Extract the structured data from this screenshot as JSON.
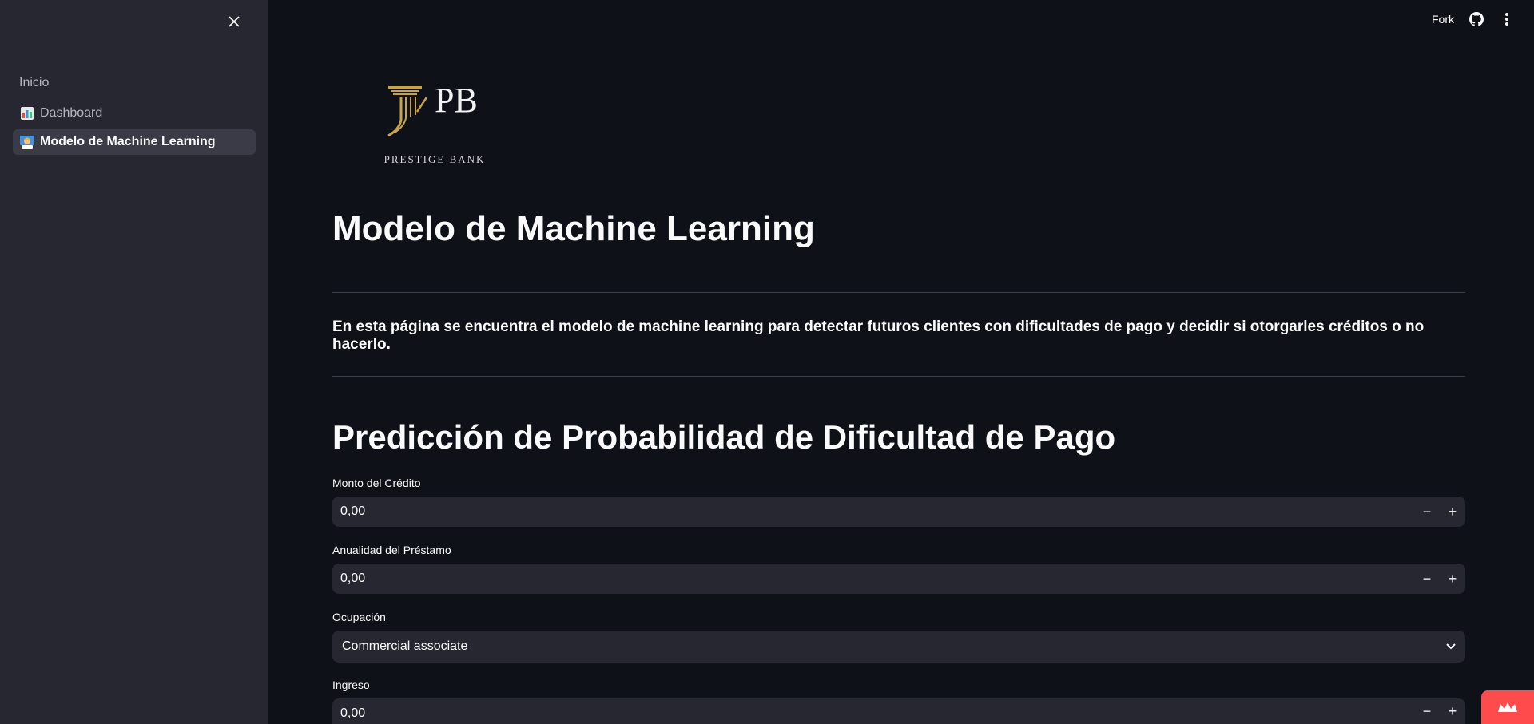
{
  "sidebar": {
    "section_label": "Inicio",
    "items": [
      {
        "label": "Dashboard",
        "icon": "bar-chart-emoji",
        "active": false
      },
      {
        "label": "Modelo de Machine Learning",
        "icon": "scientist-emoji",
        "active": true
      }
    ]
  },
  "toolbar": {
    "fork_label": "Fork"
  },
  "logo": {
    "monogram": "PB",
    "caption": "PRESTIGE BANK"
  },
  "main": {
    "title": "Modelo de Machine Learning",
    "description": "En esta página se encuentra el modelo de machine learning para detectar futuros clientes con dificultades de pago y decidir si otorgarles créditos o no hacerlo.",
    "section_title": "Predicción de Probabilidad de Dificultad de Pago",
    "fields": {
      "monto": {
        "label": "Monto del Crédito",
        "value": "0,00"
      },
      "anualidad": {
        "label": "Anualidad del Préstamo",
        "value": "0,00"
      },
      "ocupacion": {
        "label": "Ocupación",
        "value": "Commercial associate"
      },
      "ingreso": {
        "label": "Ingreso",
        "value": "0,00"
      }
    },
    "stepper": {
      "minus": "−",
      "plus": "+"
    }
  },
  "colors": {
    "background": "#0e1117",
    "sidebar": "#262730",
    "accent": "#ff4b4b",
    "gold": "#c9a24b"
  }
}
